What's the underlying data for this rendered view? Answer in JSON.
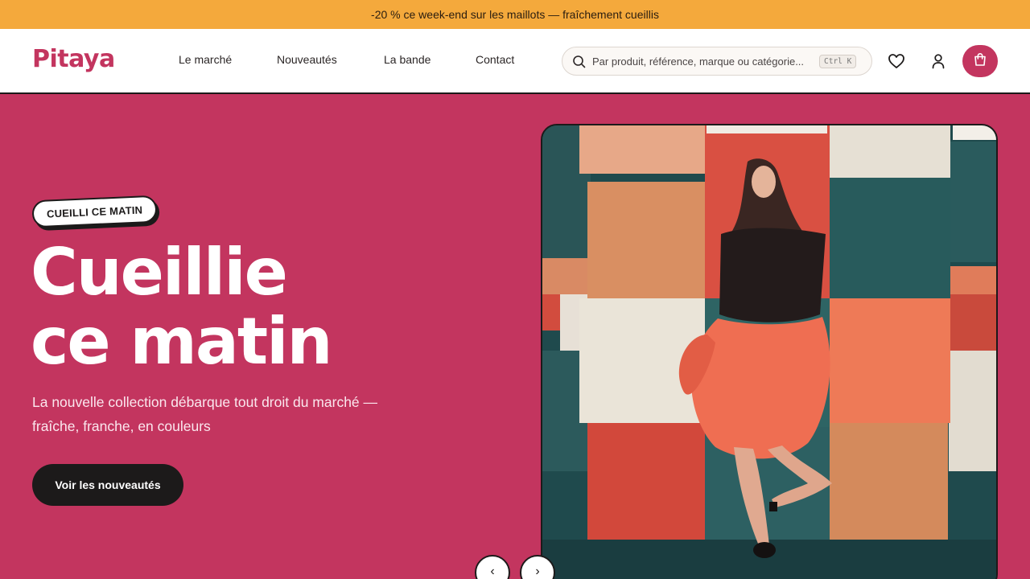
{
  "promo": {
    "text": "-20 % ce week-end sur les maillots — fraîchement cueillis"
  },
  "header": {
    "logo": "Pitaya",
    "nav": [
      "Le marché",
      "Nouveautés",
      "La bande",
      "Contact"
    ],
    "search": {
      "placeholder": "Par produit, référence, marque ou catégorie...",
      "shortcut": "Ctrl K"
    },
    "icons": [
      "heart-icon",
      "user-icon",
      "shopping-bag-icon"
    ]
  },
  "hero": {
    "badge": "CUEILLI CE MATIN",
    "headline": [
      "Cueillie",
      "ce matin"
    ],
    "subtitle": "La nouvelle collection débarque tout droit du marché — fraîche, franche, en couleurs",
    "cta": "Voir les nouveautés",
    "carousel": {
      "prev": "‹",
      "next": "›"
    }
  },
  "colors": {
    "promo_bg": "#f4a93c",
    "brand": "#c3355f",
    "dark": "#1c1a1a",
    "header_bg": "#ffffff"
  }
}
